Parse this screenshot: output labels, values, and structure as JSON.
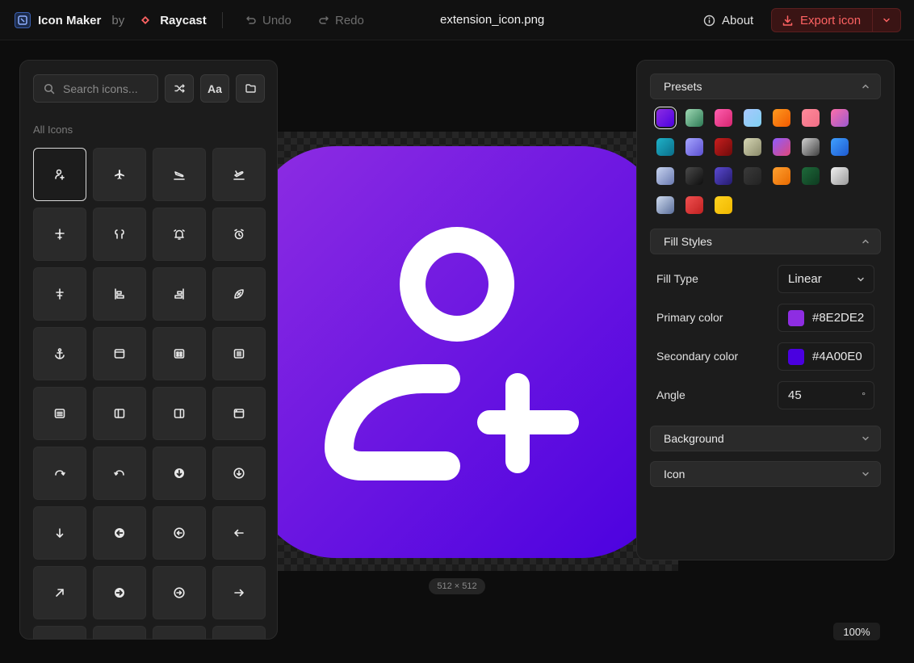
{
  "header": {
    "app_title": "Icon Maker",
    "by_label": "by",
    "partner_name": "Raycast",
    "undo_label": "Undo",
    "redo_label": "Redo",
    "filename": "extension_icon.png",
    "about_label": "About",
    "export_label": "Export icon"
  },
  "left_panel": {
    "search_placeholder": "Search icons...",
    "font_button_label": "Aa",
    "section_label": "All Icons",
    "icons": [
      "add-person-icon",
      "airplane-icon",
      "airplane-landing-icon",
      "airplane-takeoff-icon",
      "airplane-filled-icon",
      "airpods-icon",
      "alarm-ringing-icon",
      "alarm-icon",
      "align-centre-icon",
      "align-left-icon",
      "align-right-icon",
      "american-football-icon",
      "anchor-icon",
      "app-window-icon",
      "app-window-grid-2x2-icon",
      "app-window-grid-3x3-icon",
      "app-window-list-icon",
      "app-window-sidebar-left-icon",
      "app-window-sidebar-right-icon",
      "app-window-2-icon",
      "arrow-clockwise-icon",
      "arrow-counter-clockwise-icon",
      "arrow-down-circle-filled-icon",
      "arrow-down-circle-icon",
      "arrow-down-icon",
      "arrow-left-circle-filled-icon",
      "arrow-left-circle-icon",
      "arrow-left-icon",
      "arrow-ne-icon",
      "arrow-right-circle-filled-icon",
      "arrow-right-circle-icon",
      "arrow-right-icon",
      "partial-icon",
      "partial-icon",
      "partial-icon",
      "partial-icon"
    ]
  },
  "canvas": {
    "size_label": "512 × 512",
    "zoom_label": "100%",
    "selected_icon": "add-person-icon"
  },
  "right_panel": {
    "presets_label": "Presets",
    "presets": [
      {
        "from": "#8E2DE2",
        "to": "#4A00E0"
      },
      {
        "from": "#9fd9b4",
        "to": "#2d7a55"
      },
      {
        "from": "#ff5fb0",
        "to": "#d6246e"
      },
      {
        "from": "#a8c8ff",
        "to": "#7fd0f0"
      },
      {
        "from": "#ff9a1f",
        "to": "#f05a00"
      },
      {
        "from": "#ff8a9a",
        "to": "#f06e86"
      },
      {
        "from": "#ff6fa8",
        "to": "#9b59d0"
      },
      {
        "from": "#1fb2c8",
        "to": "#0a6e8a"
      },
      {
        "from": "#a6a6ff",
        "to": "#5b4fd0"
      },
      {
        "from": "#c81e1e",
        "to": "#6e0a0a"
      },
      {
        "from": "#d6d6b4",
        "to": "#8a8a6a"
      },
      {
        "from": "#8e5cff",
        "to": "#e0487a"
      },
      {
        "from": "#d0d0d0",
        "to": "#404040"
      },
      {
        "from": "#3fa0ff",
        "to": "#1e5ad0"
      },
      {
        "from": "#c8d4f0",
        "to": "#6a7ab0"
      },
      {
        "from": "#4a4a4a",
        "to": "#0e0e0e"
      },
      {
        "from": "#5a4ad0",
        "to": "#241a6e"
      },
      {
        "from": "#3a3a3a",
        "to": "#222222"
      },
      {
        "from": "#ffa030",
        "to": "#e86a00"
      },
      {
        "from": "#1e6a3a",
        "to": "#0e3a20"
      },
      {
        "from": "#f0f0f0",
        "to": "#9a9a9a"
      },
      {
        "from": "#d0dcf0",
        "to": "#5a6e9a"
      },
      {
        "from": "#f05050",
        "to": "#c02020"
      },
      {
        "from": "#ffd21f",
        "to": "#f0b800"
      }
    ],
    "fill_styles_label": "Fill Styles",
    "fill_type_label": "Fill Type",
    "fill_type_value": "Linear",
    "primary_color_label": "Primary color",
    "primary_color": "#8E2DE2",
    "secondary_color_label": "Secondary color",
    "secondary_color": "#4A00E0",
    "angle_label": "Angle",
    "angle_value": "45",
    "degree_symbol": "°",
    "background_label": "Background",
    "icon_label": "Icon"
  },
  "colors": {
    "accent_red": "#ff6363",
    "panel_bg": "#1c1c1c",
    "page_bg": "#0d0d0d"
  }
}
